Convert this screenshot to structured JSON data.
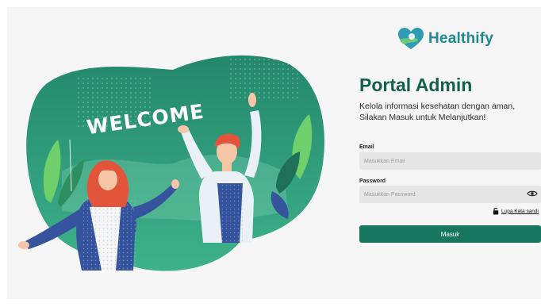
{
  "brand": {
    "name": "Healthify"
  },
  "illustration": {
    "banner_text": "WELCOME"
  },
  "login": {
    "title": "Portal Admin",
    "subtitle": "Kelola informasi kesehatan dengan aman, Silakan Masuk untuk Melanjutkan!",
    "email_label": "Email",
    "email_placeholder": "Masukkan Email",
    "password_label": "Password",
    "password_placeholder": "Masukkan Password",
    "forgot_label": "Lupa Kata sandi",
    "submit_label": "Masuk"
  },
  "icons": {
    "logo": "heart-hand-icon",
    "password_toggle": "eye-icon",
    "forgot": "unlock-icon"
  },
  "colors": {
    "primary": "#17775e",
    "title": "#13604e",
    "brand_text": "#1f8a93",
    "illustration_bg": "#2a9b78"
  }
}
